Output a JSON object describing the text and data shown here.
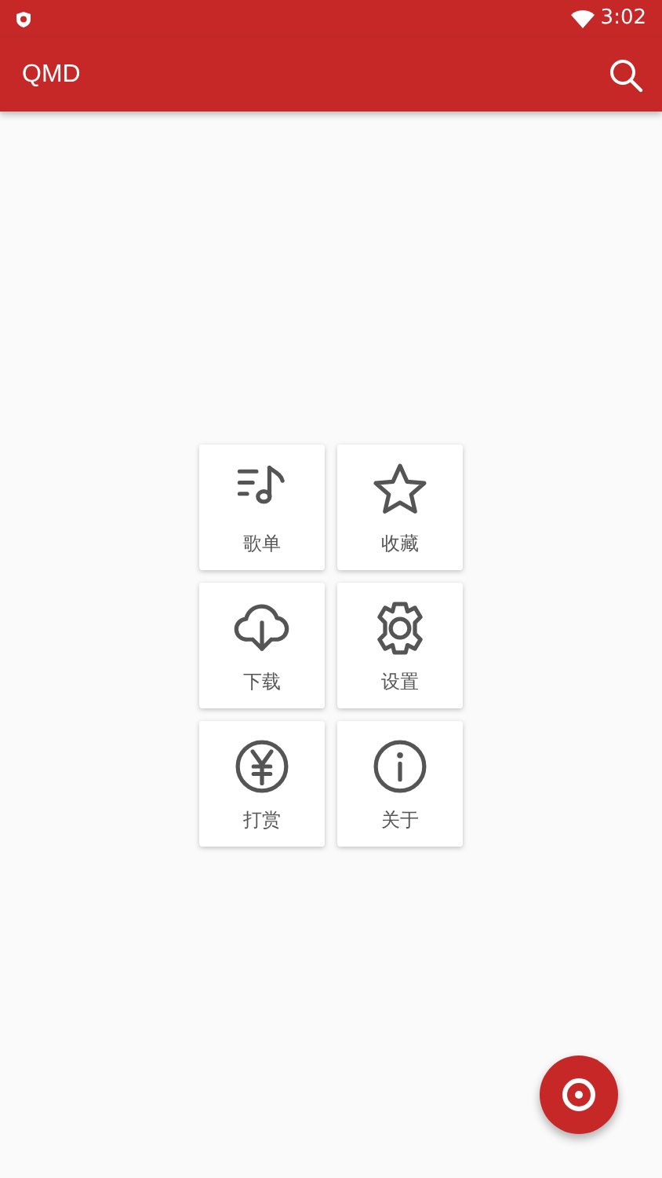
{
  "status_bar": {
    "time": "3:02"
  },
  "app_bar": {
    "title": "QMD"
  },
  "menu": [
    {
      "kind": "playlist",
      "label": "歌单"
    },
    {
      "kind": "star",
      "label": "收藏"
    },
    {
      "kind": "download",
      "label": "下载"
    },
    {
      "kind": "settings",
      "label": "设置"
    },
    {
      "kind": "yen",
      "label": "打赏"
    },
    {
      "kind": "info",
      "label": "关于"
    }
  ]
}
